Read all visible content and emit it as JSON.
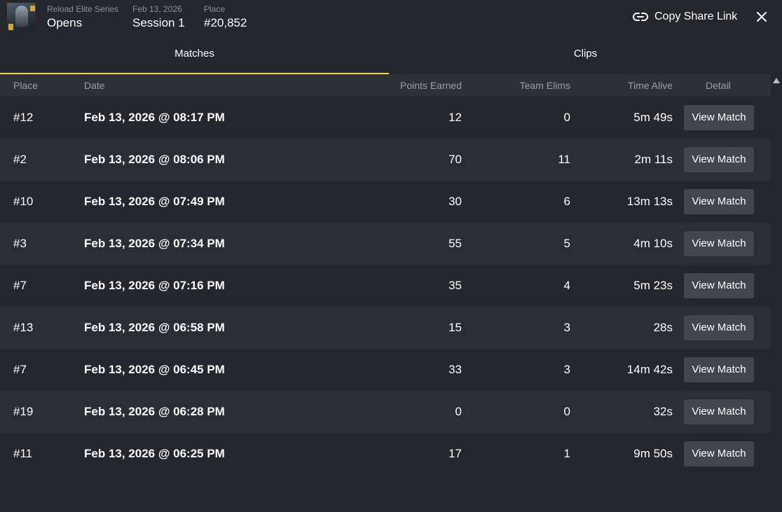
{
  "header": {
    "event_label": "Reload Elite Series",
    "event_value": "Opens",
    "date_label": "Feb 13, 2026",
    "date_value": "Session 1",
    "place_label": "Place",
    "place_value": "#20,852",
    "share_label": "Copy Share Link",
    "icons": {
      "share": "link-icon",
      "close": "close-icon",
      "avatar": "player-avatar"
    }
  },
  "tabs": [
    {
      "label": "Matches",
      "active": true
    },
    {
      "label": "Clips",
      "active": false
    }
  ],
  "table": {
    "columns": {
      "place": "Place",
      "date": "Date",
      "points": "Points Earned",
      "elims": "Team Elims",
      "time": "Time Alive",
      "detail": "Detail"
    },
    "button_label": "View Match",
    "rows": [
      {
        "place": "#12",
        "date": "Feb 13, 2026 @ 08:17 PM",
        "points": "12",
        "elims": "0",
        "time": "5m 49s"
      },
      {
        "place": "#2",
        "date": "Feb 13, 2026 @ 08:06 PM",
        "points": "70",
        "elims": "11",
        "time": "2m 11s"
      },
      {
        "place": "#10",
        "date": "Feb 13, 2026 @ 07:49 PM",
        "points": "30",
        "elims": "6",
        "time": "13m 13s"
      },
      {
        "place": "#3",
        "date": "Feb 13, 2026 @ 07:34 PM",
        "points": "55",
        "elims": "5",
        "time": "4m 10s"
      },
      {
        "place": "#7",
        "date": "Feb 13, 2026 @ 07:16 PM",
        "points": "35",
        "elims": "4",
        "time": "5m 23s"
      },
      {
        "place": "#13",
        "date": "Feb 13, 2026 @ 06:58 PM",
        "points": "15",
        "elims": "3",
        "time": "28s"
      },
      {
        "place": "#7",
        "date": "Feb 13, 2026 @ 06:45 PM",
        "points": "33",
        "elims": "3",
        "time": "14m 42s"
      },
      {
        "place": "#19",
        "date": "Feb 13, 2026 @ 06:28 PM",
        "points": "0",
        "elims": "0",
        "time": "32s"
      },
      {
        "place": "#11",
        "date": "Feb 13, 2026 @ 06:25 PM",
        "points": "17",
        "elims": "1",
        "time": "9m 50s"
      }
    ]
  },
  "colors": {
    "background": "#25272d",
    "row_alt": "#2a2d33",
    "header_row": "#2d3036",
    "accent": "#e8d94f",
    "button": "#42454c"
  }
}
